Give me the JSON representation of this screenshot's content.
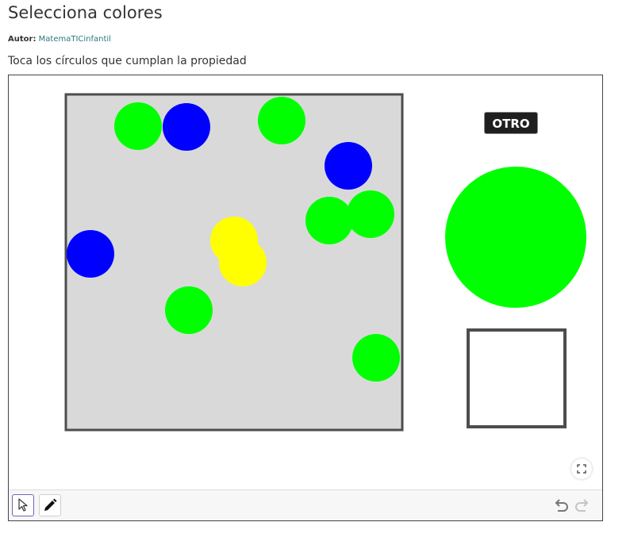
{
  "header": {
    "title": "Selecciona colores",
    "author_label": "Autor:",
    "author_name": "MatemaTICinfantil",
    "instructions": "Toca los círculos que cumplan la propiedad"
  },
  "applet": {
    "otro_label": "OTRO",
    "colors": {
      "green": "#00ff00",
      "blue": "#0000ff",
      "yellow": "#ffff00",
      "board": "#d9d9d9",
      "border": "#4d4d4d"
    },
    "target_color": "green",
    "circles": [
      {
        "color": "green"
      },
      {
        "color": "blue"
      },
      {
        "color": "green"
      },
      {
        "color": "blue"
      },
      {
        "color": "green"
      },
      {
        "color": "green"
      },
      {
        "color": "yellow"
      },
      {
        "color": "yellow"
      },
      {
        "color": "blue"
      },
      {
        "color": "green"
      },
      {
        "color": "green"
      }
    ]
  },
  "toolbar": {
    "tools": [
      "move-tool",
      "pen-tool"
    ],
    "actions": [
      "undo",
      "redo"
    ]
  }
}
